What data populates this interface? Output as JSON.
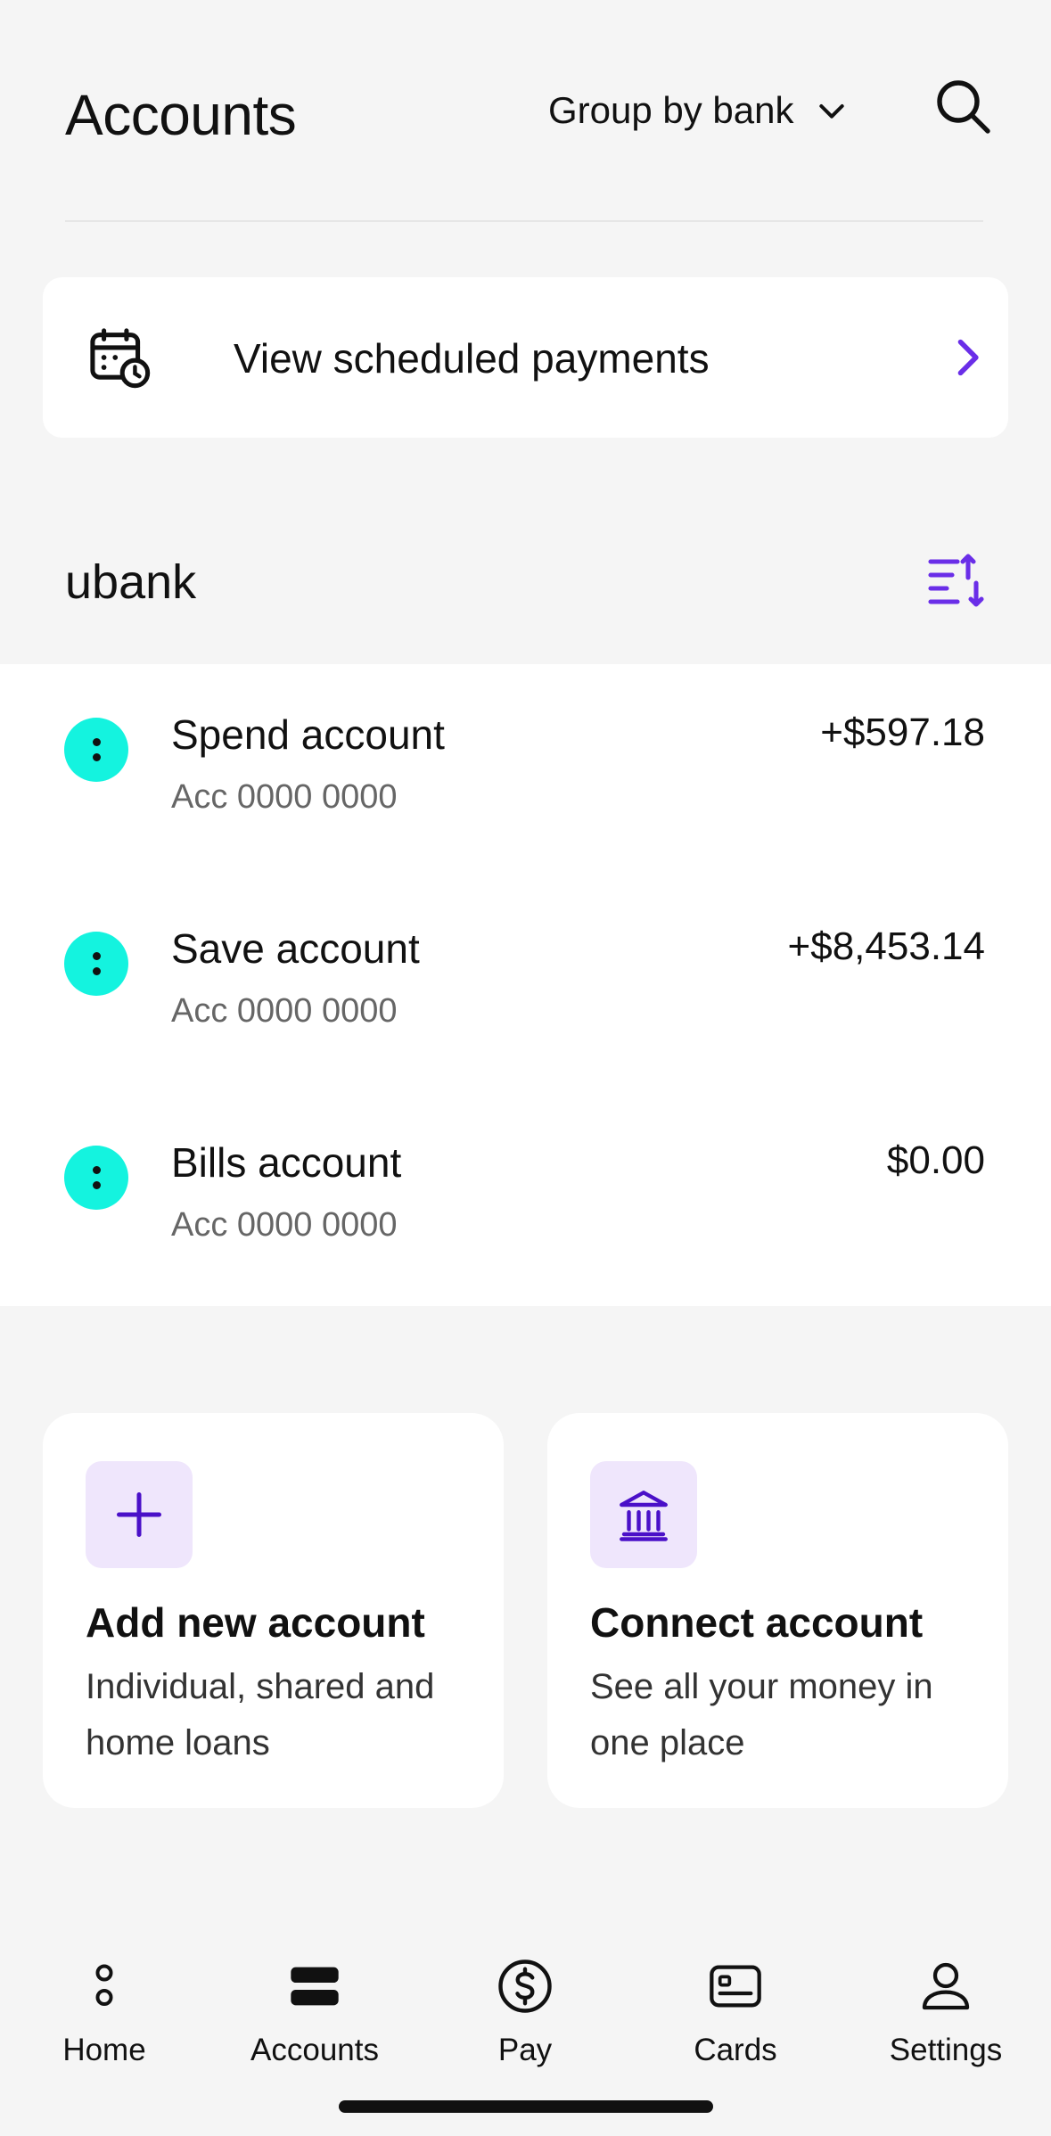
{
  "header": {
    "title": "Accounts",
    "group_by_label": "Group by bank",
    "search_icon": "search-icon",
    "chevron_icon": "chevron-down-icon"
  },
  "scheduled": {
    "label": "View scheduled payments",
    "icon": "calendar-clock-icon"
  },
  "bank": {
    "name": "ubank",
    "sort_icon": "sort-icon"
  },
  "accounts": [
    {
      "name": "Spend account",
      "number": "Acc 0000 0000",
      "balance": "+$597.18"
    },
    {
      "name": "Save account",
      "number": "Acc 0000 0000",
      "balance": "+$8,453.14"
    },
    {
      "name": "Bills account",
      "number": "Acc 0000 0000",
      "balance": "$0.00"
    }
  ],
  "actions": [
    {
      "title": "Add new account",
      "description": "Individual, shared and home loans",
      "icon": "plus-icon"
    },
    {
      "title": "Connect account",
      "description": "See all your money in one place",
      "icon": "bank-icon"
    }
  ],
  "tabbar": {
    "items": [
      {
        "label": "Home",
        "icon": "home-icon"
      },
      {
        "label": "Accounts",
        "icon": "accounts-icon"
      },
      {
        "label": "Pay",
        "icon": "pay-icon"
      },
      {
        "label": "Cards",
        "icon": "card-icon"
      },
      {
        "label": "Settings",
        "icon": "user-icon"
      }
    ]
  },
  "colors": {
    "accent": "#6a2ee8",
    "account_dot": "#14f3df",
    "icon_bg": "#efe6fc",
    "background": "#f5f5f5"
  }
}
